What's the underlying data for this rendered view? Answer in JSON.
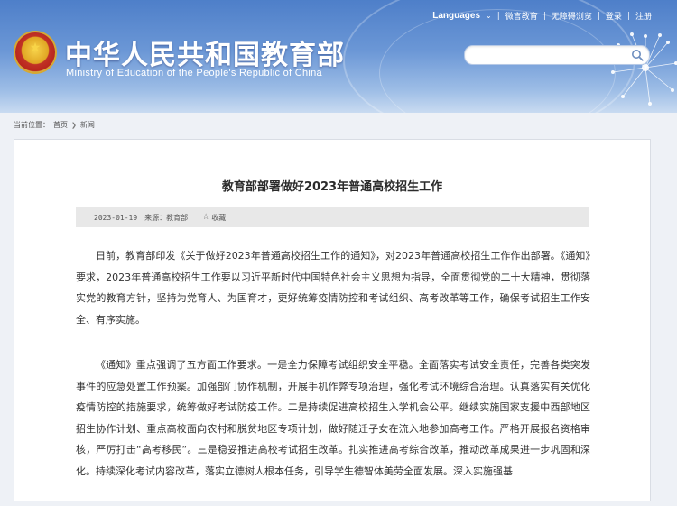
{
  "header": {
    "title": "中华人民共和国教育部",
    "subtitle": "Ministry of Education of the People's Republic of China"
  },
  "topnav": {
    "languages": "Languages",
    "weibo": "微言教育",
    "accessible": "无障碍浏览",
    "login": "登录",
    "register": "注册"
  },
  "search": {
    "placeholder": ""
  },
  "breadcrumb": {
    "label": "当前位置：",
    "home": "首页",
    "section": "新闻"
  },
  "article": {
    "title": "教育部部署做好2023年普通高校招生工作",
    "date": "2023-01-19",
    "source": "来源：教育部",
    "favorite": "收藏",
    "paragraphs": [
      "日前，教育部印发《关于做好2023年普通高校招生工作的通知》，对2023年普通高校招生工作作出部署。《通知》要求，2023年普通高校招生工作要以习近平新时代中国特色社会主义思想为指导，全面贯彻党的二十大精神，贯彻落实党的教育方针，坚持为党育人、为国育才，更好统筹疫情防控和考试组织、高考改革等工作，确保考试招生工作安全、有序实施。",
      "《通知》重点强调了五方面工作要求。一是全力保障考试组织安全平稳。全面落实考试安全责任，完善各类突发事件的应急处置工作预案。加强部门协作机制，开展手机作弊专项治理，强化考试环境综合治理。认真落实有关优化疫情防控的措施要求，统筹做好考试防疫工作。二是持续促进高校招生入学机会公平。继续实施国家支援中西部地区招生协作计划、重点高校面向农村和脱贫地区专项计划，做好随迁子女在流入地参加高考工作。严格开展报名资格审核，严厉打击“高考移民”。三是稳妥推进高校考试招生改革。扎实推进高考综合改革，推动改革成果进一步巩固和深化。持续深化考试内容改革，落实立德树人根本任务，引导学生德智体美劳全面发展。深入实施强基"
    ]
  }
}
